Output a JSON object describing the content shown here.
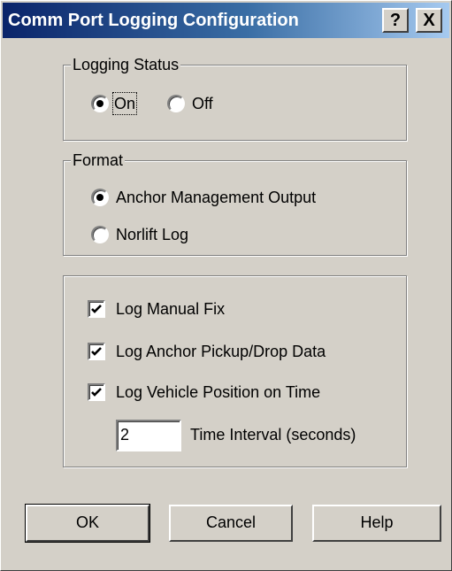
{
  "window": {
    "title": "Comm Port Logging Configuration",
    "help_button": "?",
    "close_button": "X"
  },
  "logging_status": {
    "legend": "Logging Status",
    "on_label": "On",
    "off_label": "Off",
    "selected": "On"
  },
  "format": {
    "legend": "Format",
    "option1_label": "Anchor Management Output",
    "option2_label": "Norlift Log",
    "selected": "Anchor Management Output"
  },
  "options": {
    "log_manual_fix": {
      "label": "Log Manual Fix",
      "checked": true
    },
    "log_anchor": {
      "label": "Log Anchor Pickup/Drop Data",
      "checked": true
    },
    "log_vehicle": {
      "label": "Log Vehicle Position on Time",
      "checked": true
    },
    "interval_value": "2",
    "interval_label": "Time Interval (seconds)"
  },
  "buttons": {
    "ok": "OK",
    "cancel": "Cancel",
    "help": "Help"
  },
  "colors": {
    "face": "#d4d0c8",
    "title_start": "#0a246a",
    "title_end": "#a6caf0"
  }
}
